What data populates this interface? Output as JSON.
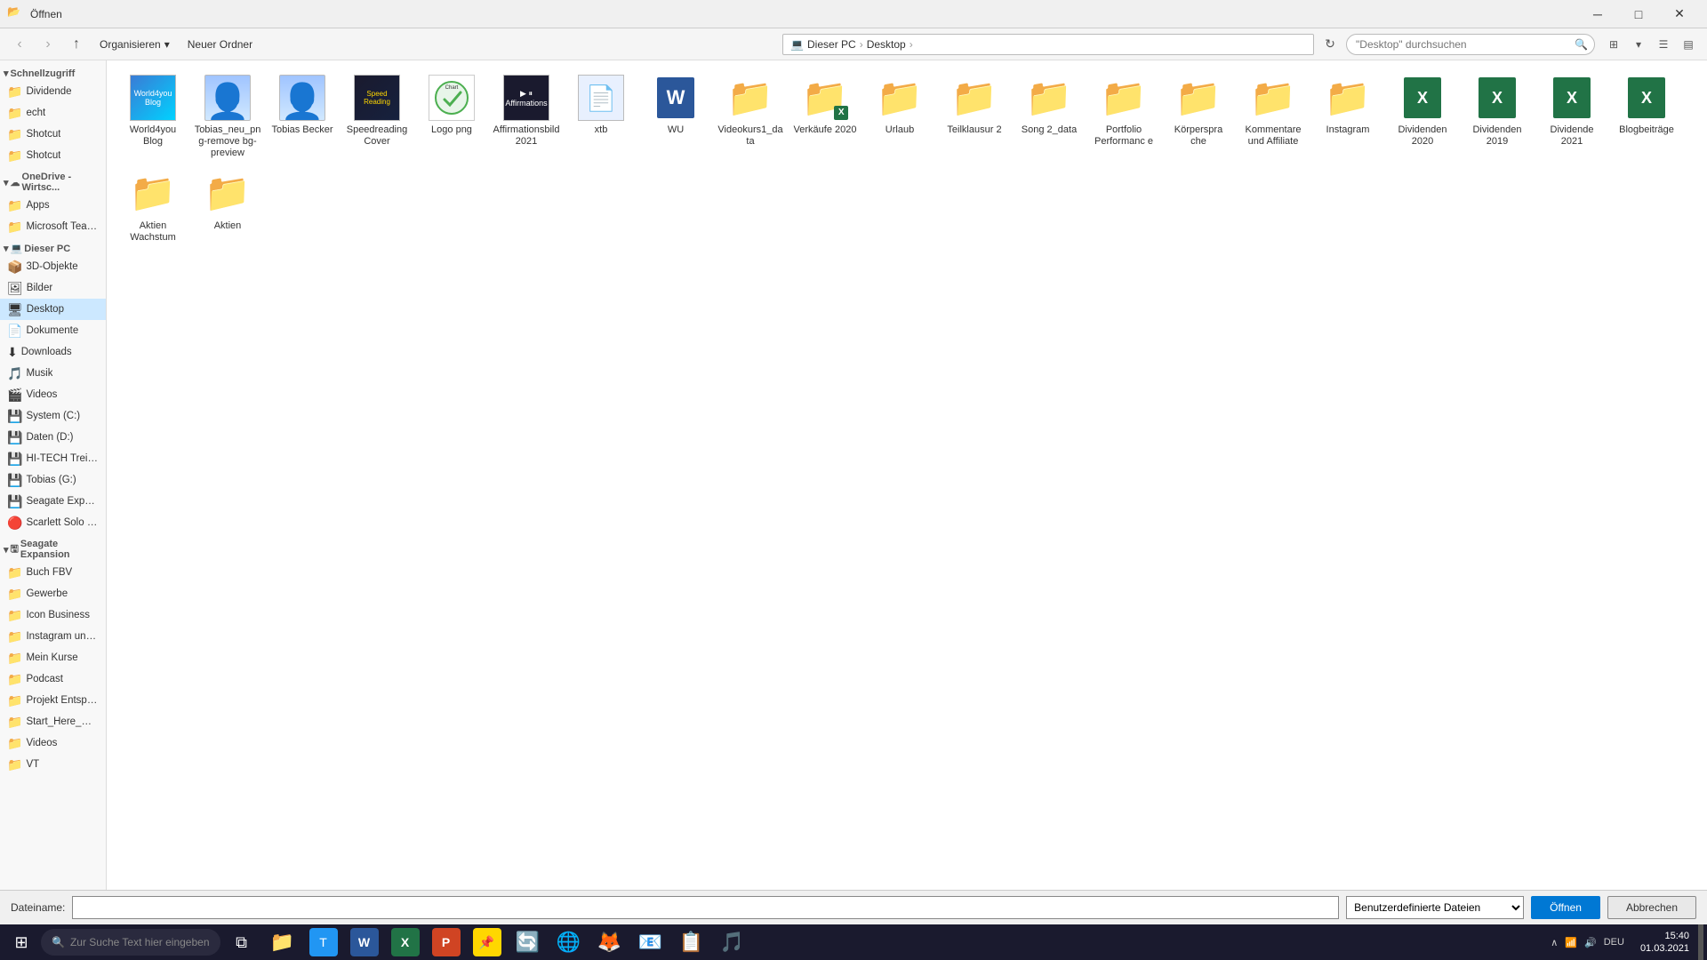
{
  "titleBar": {
    "title": "Öffnen",
    "icon": "📁"
  },
  "toolbar": {
    "organizeLabel": "Organisieren",
    "newFolderLabel": "Neuer Ordner",
    "viewDropdownLabel": "▾"
  },
  "addressBar": {
    "path": [
      "Dieser PC",
      "Desktop"
    ],
    "searchPlaceholder": "\"Desktop\" durchsuchen"
  },
  "sidebar": {
    "quickAccess": {
      "label": "Schnellzugriff",
      "items": [
        {
          "id": "dividende",
          "label": "Dividende",
          "icon": "📁"
        },
        {
          "id": "echt",
          "label": "echt",
          "icon": "📁"
        },
        {
          "id": "shotcut1",
          "label": "Shotcut",
          "icon": "📁"
        },
        {
          "id": "shotcut2",
          "label": "Shotcut",
          "icon": "📁"
        }
      ]
    },
    "oneDrive": {
      "label": "OneDrive - Wirtsc...",
      "items": [
        {
          "id": "apps",
          "label": "Apps",
          "icon": "📁"
        },
        {
          "id": "microsoft-teams",
          "label": "Microsoft Teams",
          "icon": "📁"
        }
      ]
    },
    "thisPc": {
      "label": "Dieser PC",
      "items": [
        {
          "id": "3d-objekte",
          "label": "3D-Objekte",
          "icon": "📦"
        },
        {
          "id": "bilder",
          "label": "Bilder",
          "icon": "🖼"
        },
        {
          "id": "desktop",
          "label": "Desktop",
          "icon": "🖥"
        },
        {
          "id": "dokumente",
          "label": "Dokumente",
          "icon": "📄"
        },
        {
          "id": "downloads",
          "label": "Downloads",
          "icon": "⬇"
        },
        {
          "id": "musik",
          "label": "Musik",
          "icon": "🎵"
        },
        {
          "id": "videos",
          "label": "Videos",
          "icon": "🎬"
        },
        {
          "id": "system-c",
          "label": "System (C:)",
          "icon": "💾"
        },
        {
          "id": "daten-d",
          "label": "Daten (D:)",
          "icon": "💾"
        },
        {
          "id": "hitech",
          "label": "HI-TECH Treiber",
          "icon": "💾"
        },
        {
          "id": "tobias-g",
          "label": "Tobias (G:)",
          "icon": "💾"
        },
        {
          "id": "seagate-exp",
          "label": "Seagate Expansi...",
          "icon": "💾"
        },
        {
          "id": "scarlett-solo",
          "label": "Scarlett Solo USE",
          "icon": "🔴"
        }
      ]
    },
    "seagateExpansion": {
      "label": "Seagate Expansion",
      "items": [
        {
          "id": "buch-fbv",
          "label": "Buch FBV",
          "icon": "📁"
        },
        {
          "id": "gewerbe",
          "label": "Gewerbe",
          "icon": "📁"
        },
        {
          "id": "icon-business",
          "label": "Icon Business",
          "icon": "📁"
        },
        {
          "id": "instagram-t",
          "label": "Instagram und T...",
          "icon": "📁"
        },
        {
          "id": "mein-kurse",
          "label": "Mein Kurse",
          "icon": "📁"
        },
        {
          "id": "podcast",
          "label": "Podcast",
          "icon": "📁"
        },
        {
          "id": "projekt-entspan",
          "label": "Projekt Entspann...",
          "icon": "📁"
        },
        {
          "id": "start-here",
          "label": "Start_Here_Mac...",
          "icon": "📁"
        },
        {
          "id": "videos2",
          "label": "Videos",
          "icon": "📁"
        },
        {
          "id": "vt",
          "label": "VT",
          "icon": "📁"
        }
      ]
    }
  },
  "files": [
    {
      "id": "world4you",
      "name": "World4you Blog",
      "type": "blog-thumb"
    },
    {
      "id": "tobias-neu",
      "name": "Tobias_neu_png-remove bg-preview",
      "type": "person-thumb"
    },
    {
      "id": "tobias-becker",
      "name": "Tobias Becker",
      "type": "person-thumb"
    },
    {
      "id": "speedreading",
      "name": "Speedreading Cover",
      "type": "cover-thumb"
    },
    {
      "id": "logo-png",
      "name": "Logo png",
      "type": "logo-png"
    },
    {
      "id": "affirmations",
      "name": "Affirmationsbild 2021",
      "type": "affirmations-thumb"
    },
    {
      "id": "xtb-file",
      "name": "xtb",
      "type": "file-blue"
    },
    {
      "id": "wu",
      "name": "WU",
      "type": "word"
    },
    {
      "id": "videokurs",
      "name": "Videokurs1_data",
      "type": "folder"
    },
    {
      "id": "verkaufe",
      "name": "Verkäufe 2020",
      "type": "folder-excel"
    },
    {
      "id": "urlaub",
      "name": "Urlaub",
      "type": "folder-photo"
    },
    {
      "id": "teilklausur2",
      "name": "Teilklausur 2",
      "type": "folder"
    },
    {
      "id": "song2",
      "name": "Song 2_data",
      "type": "folder"
    },
    {
      "id": "portfolio",
      "name": "Portfolio Performanc e",
      "type": "folder"
    },
    {
      "id": "korpersprache",
      "name": "Körperspra che",
      "type": "folder"
    },
    {
      "id": "kommentare",
      "name": "Kommentare und Affiliate",
      "type": "folder"
    },
    {
      "id": "instagram",
      "name": "Instagram",
      "type": "folder"
    },
    {
      "id": "dividenden2020",
      "name": "Dividenden 2020",
      "type": "excel"
    },
    {
      "id": "dividenden2019",
      "name": "Dividenden 2019",
      "type": "excel"
    },
    {
      "id": "dividende2021",
      "name": "Dividende 2021",
      "type": "excel"
    },
    {
      "id": "blogbeitrage",
      "name": "Blogbeiträge",
      "type": "excel"
    },
    {
      "id": "aktien-wachstum",
      "name": "Aktien Wachstum",
      "type": "folder"
    },
    {
      "id": "aktien",
      "name": "Aktien",
      "type": "folder"
    }
  ],
  "dialogFooter": {
    "filenamLabel": "Dateiname:",
    "filenamePlaceholder": "",
    "filetypeValue": "Benutzerdefinierte Dateien",
    "openBtn": "Öffnen",
    "cancelBtn": "Abbrechen"
  },
  "taskbar": {
    "searchPlaceholder": "Zur Suche Text hier eingeben",
    "clock": "15:40",
    "date": "01.03.2021",
    "apps": [
      "⊞",
      "🔍",
      "📁",
      "📁",
      "W",
      "X",
      "P",
      "🎵",
      "🔄",
      "🌐",
      "🦊",
      "📧",
      "📋",
      "🎵"
    ],
    "lang": "DEU"
  }
}
